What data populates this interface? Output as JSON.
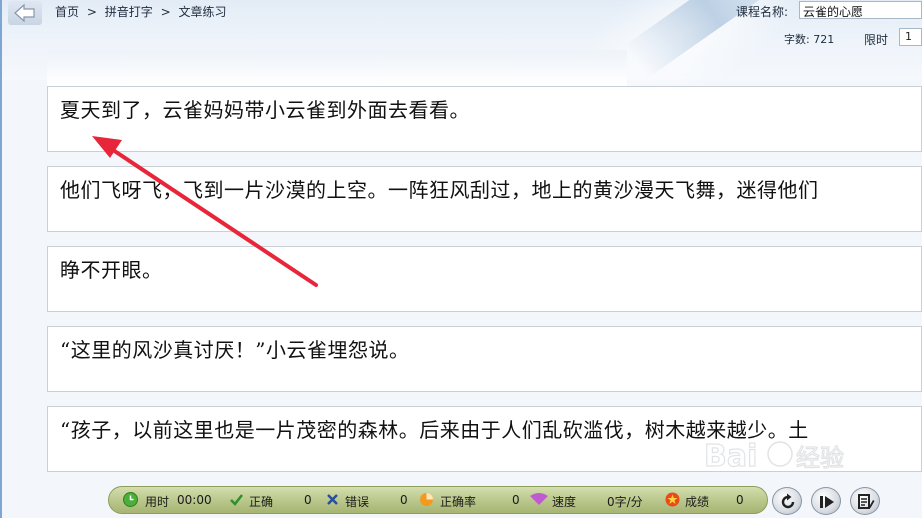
{
  "header": {
    "breadcrumb": [
      "首页",
      ">",
      "拼音打字",
      ">",
      "文章练习"
    ],
    "course_label": "课程名称:",
    "course_value": "云雀的心愿",
    "word_count": "字数: 721",
    "time_limit_label": "限时",
    "time_limit_value": "1"
  },
  "lines": [
    "夏天到了，云雀妈妈带小云雀到外面去看看。",
    "他们飞呀飞，飞到一片沙漠的上空。一阵狂风刮过，地上的黄沙漫天飞舞，迷得他们",
    "睁不开眼。",
    "“这里的风沙真讨厌！”小云雀埋怨说。",
    "“孩子，以前这里也是一片茂密的森林。后来由于人们乱砍滥伐，树木越来越少。土"
  ],
  "status": {
    "time_label": "用时",
    "time_value": "00:00",
    "correct_label": "正确",
    "correct_value": "0",
    "error_label": "错误",
    "error_value": "0",
    "accuracy_label": "正确率",
    "accuracy_value": "0",
    "speed_label": "速度",
    "speed_value": "0字/分",
    "score_label": "成绩",
    "score_value": "0"
  },
  "icons": {
    "back": "back-arrow-icon",
    "time": "clock-icon",
    "correct": "check-icon",
    "error": "cross-icon",
    "accuracy": "pie-icon",
    "speed": "fan-icon",
    "score": "star-icon",
    "restart": "restart-icon",
    "pause": "pause-play-icon",
    "report": "report-icon"
  },
  "colors": {
    "annotation_arrow": "#e8263a",
    "status_bar": "#b8c68a"
  }
}
